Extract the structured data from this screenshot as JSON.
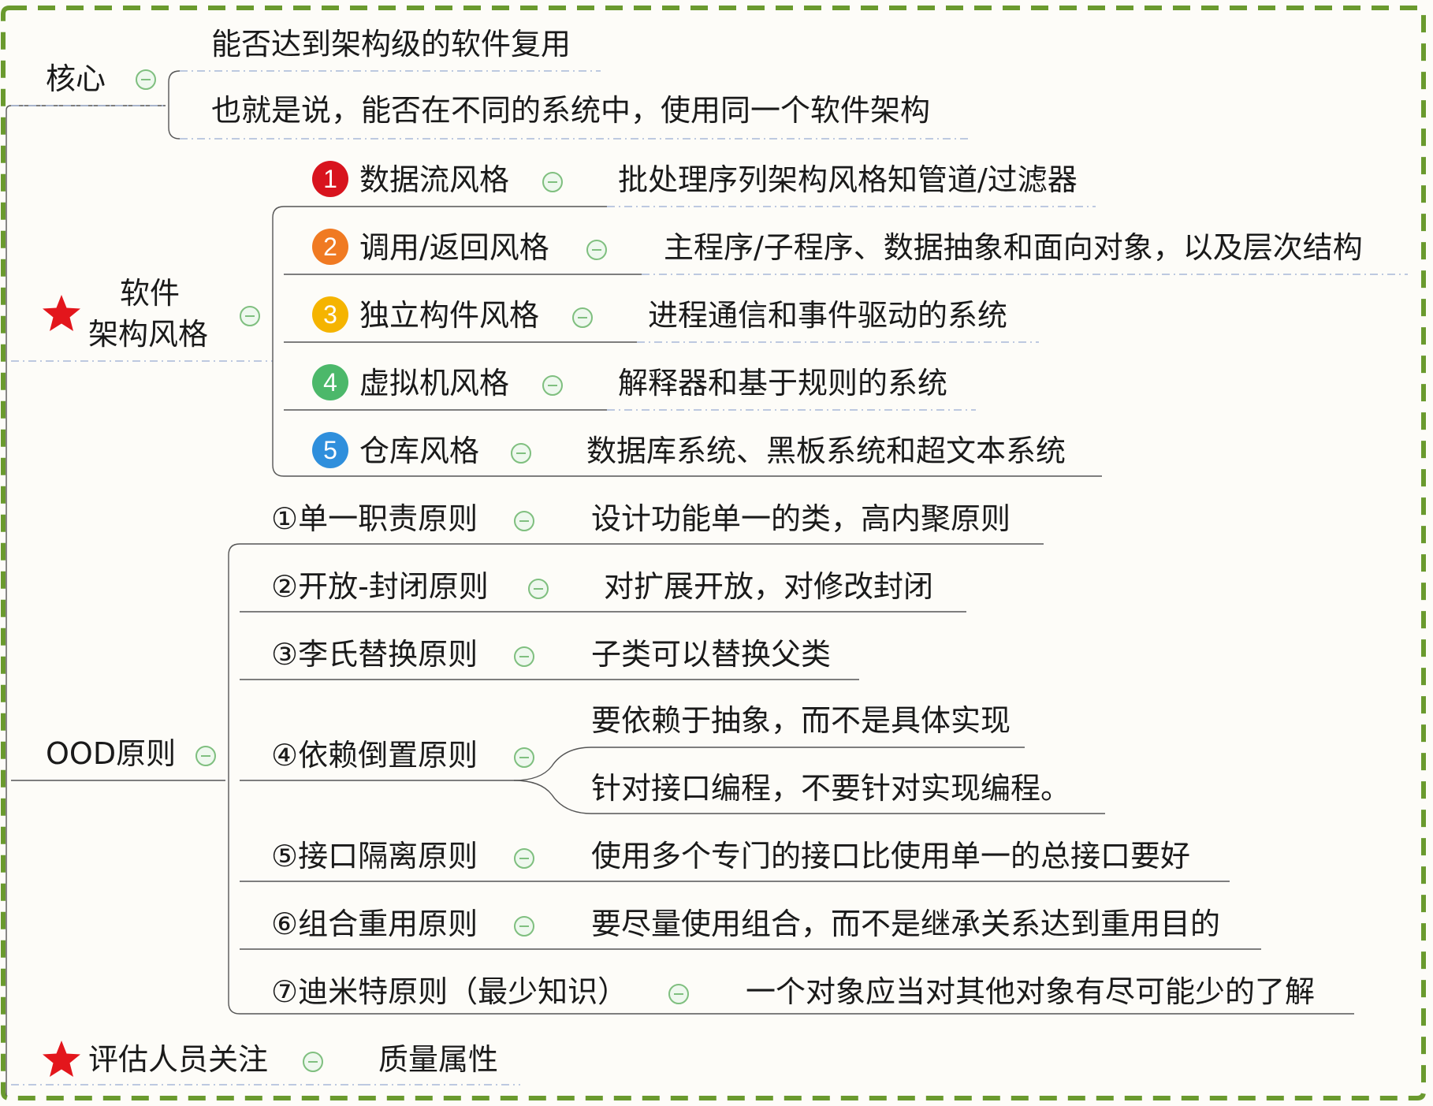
{
  "colors": {
    "frame": "#6a9a2e",
    "line": "#555555",
    "dash": "#a8b8d8",
    "collapse": "#7fbf7f",
    "star": "#e3161c",
    "badge1": "#d8141e",
    "badge2": "#f07a22",
    "badge3": "#f5b400",
    "badge4": "#4cb86a",
    "badge5": "#2f8fdc"
  },
  "icons": {
    "star": "star-icon",
    "collapse": "collapse-icon"
  },
  "core": {
    "label": "核心",
    "children": [
      "能否达到架构级的软件复用",
      "也就是说，能否在不同的系统中，使用同一个软件架构"
    ]
  },
  "styles": {
    "label_line1": "软件",
    "label_line2": "架构风格",
    "items": [
      {
        "num": "1",
        "name": "数据流风格",
        "desc": "批处理序列架构风格知管道/过滤器"
      },
      {
        "num": "2",
        "name": "调用/返回风格",
        "desc": "主程序/子程序、数据抽象和面向对象，以及层次结构"
      },
      {
        "num": "3",
        "name": "独立构件风格",
        "desc": "进程通信和事件驱动的系统"
      },
      {
        "num": "4",
        "name": "虚拟机风格",
        "desc": "解释器和基于规则的系统"
      },
      {
        "num": "5",
        "name": "仓库风格",
        "desc": "数据库系统、黑板系统和超文本系统"
      }
    ]
  },
  "ood": {
    "label": "OOD原则",
    "items": [
      {
        "name": "①单一职责原则",
        "desc": [
          "设计功能单一的类，高内聚原则"
        ]
      },
      {
        "name": "②开放-封闭原则",
        "desc": [
          "对扩展开放，对修改封闭"
        ]
      },
      {
        "name": "③李氏替换原则",
        "desc": [
          "子类可以替换父类"
        ]
      },
      {
        "name": "④依赖倒置原则",
        "desc": [
          "要依赖于抽象，而不是具体实现",
          "针对接口编程，不要针对实现编程。"
        ]
      },
      {
        "name": "⑤接口隔离原则",
        "desc": [
          "使用多个专门的接口比使用单一的总接口要好"
        ]
      },
      {
        "name": "⑥组合重用原则",
        "desc": [
          "要尽量使用组合，而不是继承关系达到重用目的"
        ]
      },
      {
        "name": "⑦迪米特原则（最少知识）",
        "desc": [
          "一个对象应当对其他对象有尽可能少的了解"
        ]
      }
    ]
  },
  "evaluator": {
    "label": "评估人员关注",
    "desc": "质量属性"
  }
}
